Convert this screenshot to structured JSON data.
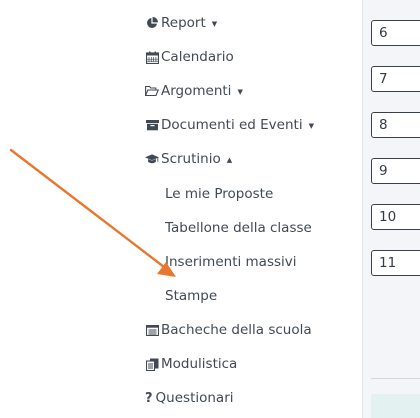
{
  "sidebar": {
    "items": [
      {
        "label": "Report",
        "icon": "pie-chart-icon",
        "caret": "▼"
      },
      {
        "label": "Calendario",
        "icon": "calendar-icon"
      },
      {
        "label": "Argomenti",
        "icon": "folder-open-icon",
        "caret": "▼"
      },
      {
        "label": "Documenti ed Eventi",
        "icon": "archive-icon",
        "caret": "▼"
      },
      {
        "label": "Scrutinio",
        "icon": "graduation-cap-icon",
        "caret": "▲"
      },
      {
        "label": "Bacheche della scuola",
        "icon": "list-icon"
      },
      {
        "label": "Modulistica",
        "icon": "file-copy-icon"
      },
      {
        "label": "Questionari",
        "icon": "question-mark-icon",
        "icon_text": "?"
      }
    ],
    "scrutinio_subitems": [
      "Le mie Proposte",
      "Tabellone della classe",
      "Inserimenti massivi",
      "Stampe"
    ]
  },
  "content": {
    "number_boxes": [
      "6",
      "7",
      "8",
      "9",
      "10",
      "11"
    ]
  },
  "colors": {
    "text": "#414a54",
    "arrow": "#e8782f",
    "content_bg": "#f3f5f8",
    "box_border": "#38414b",
    "tile": "#e3f1f1"
  }
}
